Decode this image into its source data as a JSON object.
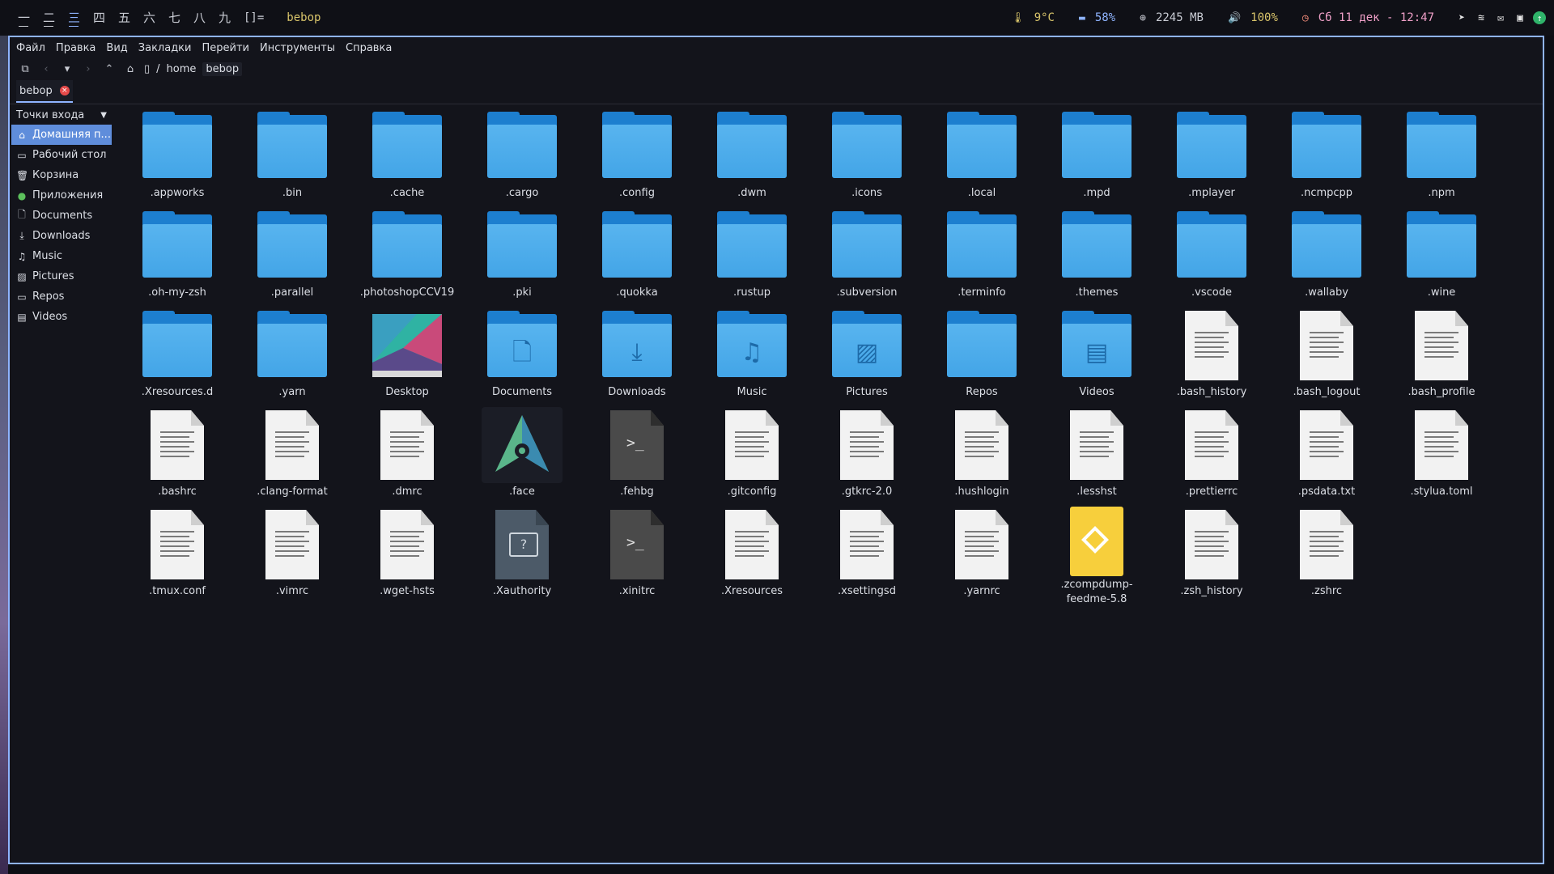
{
  "topbar": {
    "tags": [
      "一",
      "二",
      "三",
      "四",
      "五",
      "六",
      "七",
      "八",
      "九"
    ],
    "active_tag": 2,
    "layout": "[]=",
    "window_title": "bebop",
    "status": {
      "temp_icon": "thermometer-icon",
      "temp": "9°C",
      "battery_icon": "battery-icon",
      "battery": "58%",
      "mem_icon": "memory-icon",
      "mem": "2245 MB",
      "volume_icon": "volume-icon",
      "volume": "100%",
      "clock_icon": "clock-icon",
      "datetime": "Сб 11 дек - 12:47"
    }
  },
  "menu": {
    "file": "Файл",
    "edit": "Правка",
    "view": "Вид",
    "bookmarks": "Закладки",
    "go": "Перейти",
    "tools": "Инструменты",
    "help": "Справка"
  },
  "path": {
    "sep": "/",
    "parts": [
      "home",
      "bebop"
    ]
  },
  "tab": {
    "label": "bebop"
  },
  "sidebar": {
    "header": "Точки входа",
    "items": [
      {
        "label": "Домашняя п...",
        "icon": "home-icon"
      },
      {
        "label": "Рабочий стол",
        "icon": "desktop-icon"
      },
      {
        "label": "Корзина",
        "icon": "trash-icon"
      },
      {
        "label": "Приложения",
        "icon": "apps-icon"
      },
      {
        "label": "Documents",
        "icon": "document-icon"
      },
      {
        "label": "Downloads",
        "icon": "download-icon"
      },
      {
        "label": "Music",
        "icon": "music-icon"
      },
      {
        "label": "Pictures",
        "icon": "picture-icon"
      },
      {
        "label": "Repos",
        "icon": "folder-icon"
      },
      {
        "label": "Videos",
        "icon": "video-icon"
      }
    ]
  },
  "files": [
    {
      "name": ".appworks",
      "kind": "folder"
    },
    {
      "name": ".bin",
      "kind": "folder"
    },
    {
      "name": ".cache",
      "kind": "folder"
    },
    {
      "name": ".cargo",
      "kind": "folder"
    },
    {
      "name": ".config",
      "kind": "folder"
    },
    {
      "name": ".dwm",
      "kind": "folder"
    },
    {
      "name": ".icons",
      "kind": "folder"
    },
    {
      "name": ".local",
      "kind": "folder"
    },
    {
      "name": ".mpd",
      "kind": "folder"
    },
    {
      "name": ".mplayer",
      "kind": "folder"
    },
    {
      "name": ".ncmpcpp",
      "kind": "folder"
    },
    {
      "name": ".npm",
      "kind": "folder"
    },
    {
      "name": ".oh-my-zsh",
      "kind": "folder"
    },
    {
      "name": ".parallel",
      "kind": "folder"
    },
    {
      "name": ".photoshopCCV19",
      "kind": "folder"
    },
    {
      "name": ".pki",
      "kind": "folder"
    },
    {
      "name": ".quokka",
      "kind": "folder"
    },
    {
      "name": ".rustup",
      "kind": "folder"
    },
    {
      "name": ".subversion",
      "kind": "folder"
    },
    {
      "name": ".terminfo",
      "kind": "folder"
    },
    {
      "name": ".themes",
      "kind": "folder"
    },
    {
      "name": ".vscode",
      "kind": "folder"
    },
    {
      "name": ".wallaby",
      "kind": "folder"
    },
    {
      "name": ".wine",
      "kind": "folder"
    },
    {
      "name": ".Xresources.d",
      "kind": "folder"
    },
    {
      "name": ".yarn",
      "kind": "folder"
    },
    {
      "name": "Desktop",
      "kind": "desktop"
    },
    {
      "name": "Documents",
      "kind": "folder",
      "emblem": "document"
    },
    {
      "name": "Downloads",
      "kind": "folder",
      "emblem": "download"
    },
    {
      "name": "Music",
      "kind": "folder",
      "emblem": "music"
    },
    {
      "name": "Pictures",
      "kind": "folder",
      "emblem": "picture"
    },
    {
      "name": "Repos",
      "kind": "folder"
    },
    {
      "name": "Videos",
      "kind": "folder",
      "emblem": "video"
    },
    {
      "name": ".bash_history",
      "kind": "text"
    },
    {
      "name": ".bash_logout",
      "kind": "text"
    },
    {
      "name": ".bash_profile",
      "kind": "text"
    },
    {
      "name": ".bashrc",
      "kind": "text"
    },
    {
      "name": ".clang-format",
      "kind": "text"
    },
    {
      "name": ".dmrc",
      "kind": "text"
    },
    {
      "name": ".face",
      "kind": "face"
    },
    {
      "name": ".fehbg",
      "kind": "terminal"
    },
    {
      "name": ".gitconfig",
      "kind": "text"
    },
    {
      "name": ".gtkrc-2.0",
      "kind": "text"
    },
    {
      "name": ".hushlogin",
      "kind": "text"
    },
    {
      "name": ".lesshst",
      "kind": "text"
    },
    {
      "name": ".prettierrc",
      "kind": "text"
    },
    {
      "name": ".psdata.txt",
      "kind": "text"
    },
    {
      "name": ".stylua.toml",
      "kind": "text"
    },
    {
      "name": ".tmux.conf",
      "kind": "text"
    },
    {
      "name": ".vimrc",
      "kind": "text"
    },
    {
      "name": ".wget-hsts",
      "kind": "text"
    },
    {
      "name": ".Xauthority",
      "kind": "xauth"
    },
    {
      "name": ".xinitrc",
      "kind": "terminal"
    },
    {
      "name": ".Xresources",
      "kind": "text"
    },
    {
      "name": ".xsettingsd",
      "kind": "text"
    },
    {
      "name": ".yarnrc",
      "kind": "text"
    },
    {
      "name": ".zcompdump-feedme-5.8",
      "kind": "yellow"
    },
    {
      "name": ".zsh_history",
      "kind": "text"
    },
    {
      "name": ".zshrc",
      "kind": "text"
    }
  ]
}
